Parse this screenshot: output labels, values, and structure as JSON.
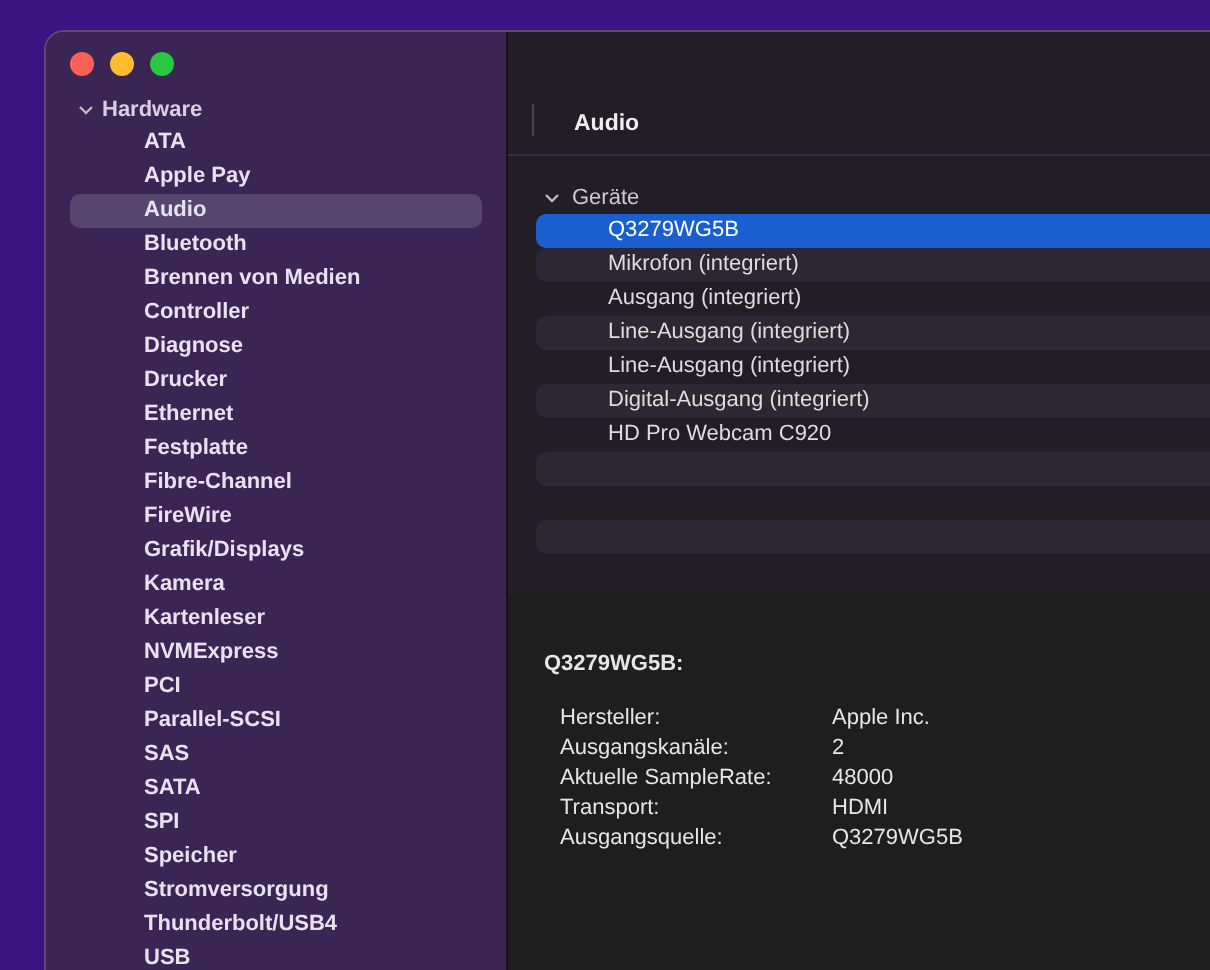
{
  "sidebar": {
    "groups": [
      {
        "label": "Hardware",
        "expanded": true,
        "children": [
          {
            "label": "ATA",
            "selected": false
          },
          {
            "label": "Apple Pay",
            "selected": false
          },
          {
            "label": "Audio",
            "selected": true
          },
          {
            "label": "Bluetooth",
            "selected": false
          },
          {
            "label": "Brennen von Medien",
            "selected": false
          },
          {
            "label": "Controller",
            "selected": false
          },
          {
            "label": "Diagnose",
            "selected": false
          },
          {
            "label": "Drucker",
            "selected": false
          },
          {
            "label": "Ethernet",
            "selected": false
          },
          {
            "label": "Festplatte",
            "selected": false
          },
          {
            "label": "Fibre-Channel",
            "selected": false
          },
          {
            "label": "FireWire",
            "selected": false
          },
          {
            "label": "Grafik/Displays",
            "selected": false
          },
          {
            "label": "Kamera",
            "selected": false
          },
          {
            "label": "Kartenleser",
            "selected": false
          },
          {
            "label": "NVMExpress",
            "selected": false
          },
          {
            "label": "PCI",
            "selected": false
          },
          {
            "label": "Parallel-SCSI",
            "selected": false
          },
          {
            "label": "SAS",
            "selected": false
          },
          {
            "label": "SATA",
            "selected": false
          },
          {
            "label": "SPI",
            "selected": false
          },
          {
            "label": "Speicher",
            "selected": false
          },
          {
            "label": "Stromversorgung",
            "selected": false
          },
          {
            "label": "Thunderbolt/USB4",
            "selected": false
          },
          {
            "label": "USB",
            "selected": false
          }
        ]
      }
    ]
  },
  "content": {
    "title": "Audio",
    "devices": {
      "label": "Geräte",
      "expanded": true,
      "children": [
        {
          "label": "Q3279WG5B",
          "selected": true
        },
        {
          "label": "Mikrofon (integriert)",
          "selected": false
        },
        {
          "label": "Ausgang (integriert)",
          "selected": false
        },
        {
          "label": "Line-Ausgang (integriert)",
          "selected": false
        },
        {
          "label": "Line-Ausgang (integriert)",
          "selected": false
        },
        {
          "label": "Digital-Ausgang (integriert)",
          "selected": false
        },
        {
          "label": "HD Pro Webcam C920",
          "selected": false
        }
      ]
    },
    "detail": {
      "title": "Q3279WG5B:",
      "fields": [
        {
          "label": "Hersteller:",
          "value": "Apple Inc."
        },
        {
          "label": "Ausgangskanäle:",
          "value": "2"
        },
        {
          "label": "Aktuelle SampleRate:",
          "value": "48000"
        },
        {
          "label": "Transport:",
          "value": "HDMI"
        },
        {
          "label": "Ausgangsquelle:",
          "value": "Q3279WG5B"
        }
      ]
    }
  }
}
